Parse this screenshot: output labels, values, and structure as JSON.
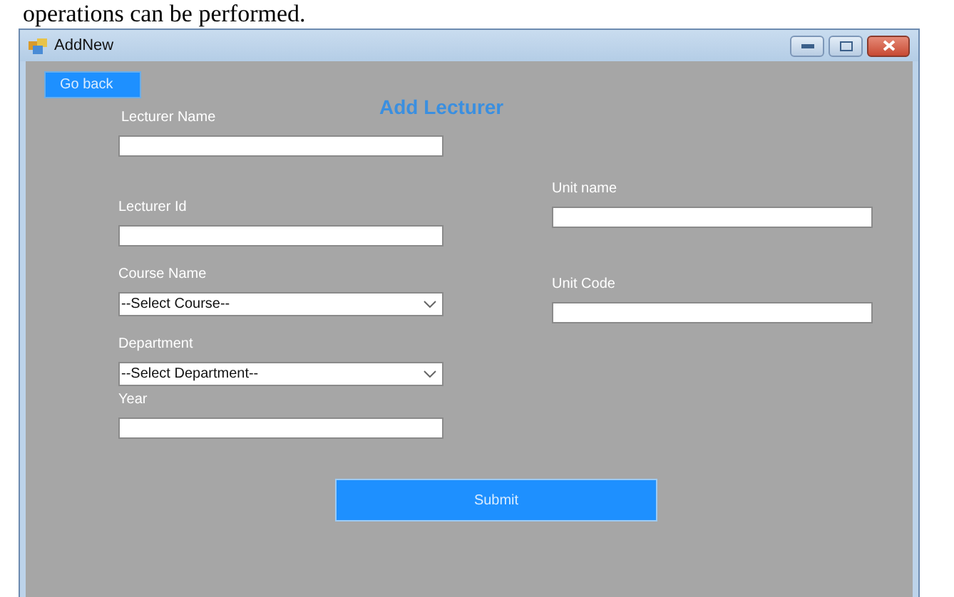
{
  "document_text": "operations can be performed.",
  "window": {
    "title": "AddNew"
  },
  "back_button": "Go back",
  "heading": "Add Lecturer",
  "left_fields": [
    {
      "kind": "text",
      "label": "Lecturer Name"
    },
    {
      "kind": "text",
      "label": "Lecturer Id"
    },
    {
      "kind": "select",
      "label": "Course Name",
      "value": "--Select Course--"
    },
    {
      "kind": "select",
      "label": "Department",
      "value": "--Select Department--"
    },
    {
      "kind": "text",
      "label": "Year"
    }
  ],
  "right_fields": [
    {
      "kind": "text",
      "label": "Unit name"
    },
    {
      "kind": "text",
      "label": "Unit Code"
    }
  ],
  "submit_button": "Submit"
}
